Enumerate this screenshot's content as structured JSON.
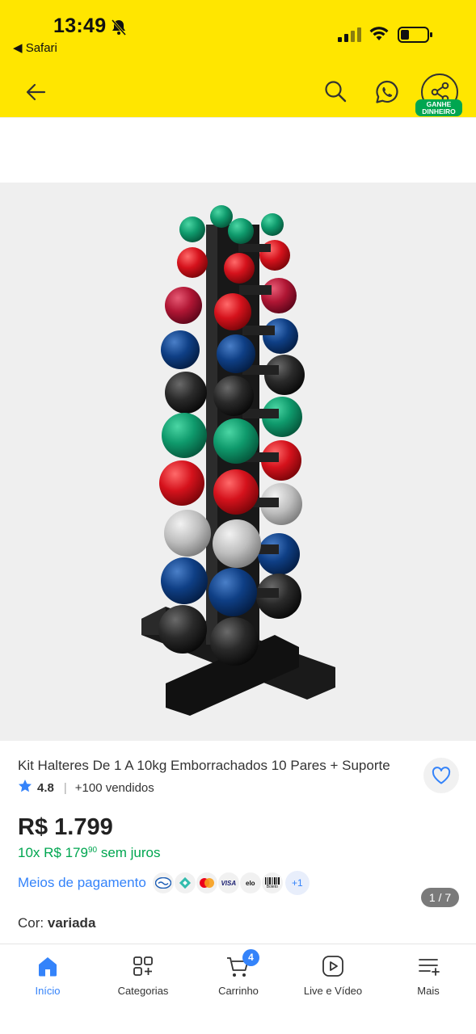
{
  "status_bar": {
    "time": "13:49",
    "back_app": "◀ Safari"
  },
  "header": {
    "share_badge_line1": "GANHE",
    "share_badge_line2": "DINHEIRO",
    "accent_color": "#ffe600"
  },
  "gallery": {
    "counter": "1 / 7"
  },
  "product": {
    "title": "Kit Halteres De 1 A 10kg Emborrachados 10 Pares + Suporte",
    "rating": "4.8",
    "sold": "+100 vendidos",
    "price": "R$ 1.799",
    "installments_prefix": "10x R$ 179",
    "installments_cents": "90",
    "installments_suffix": "sem juros",
    "payment_label": "Meios de pagamento",
    "payment_methods": [
      "mercado-pago-icon",
      "pix-icon",
      "mastercard-icon",
      "visa-icon",
      "elo-icon",
      "boleto-icon"
    ],
    "payment_visa": "VISA",
    "payment_elo": "elo",
    "payment_boleto": "Boleto",
    "payment_more": "+1",
    "color_label": "Cor:",
    "color_value": "variada"
  },
  "tabbar": {
    "tabs": [
      {
        "label": "Início",
        "icon": "home-icon",
        "active": true
      },
      {
        "label": "Categorias",
        "icon": "categories-icon",
        "active": false
      },
      {
        "label": "Carrinho",
        "icon": "cart-icon",
        "active": false,
        "badge": "4"
      },
      {
        "label": "Live e Vídeo",
        "icon": "play-icon",
        "active": false
      },
      {
        "label": "Mais",
        "icon": "more-icon",
        "active": false
      }
    ],
    "active_color": "#3483fa"
  }
}
